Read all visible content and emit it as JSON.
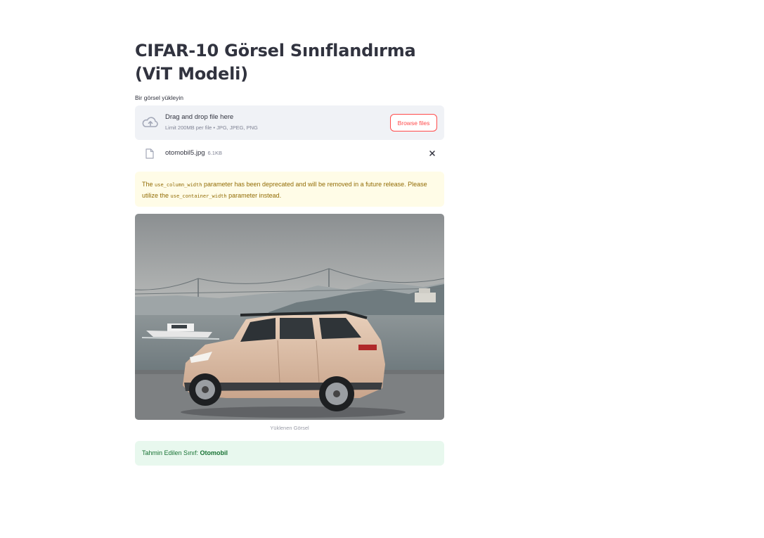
{
  "page": {
    "title": "CIFAR-10 Görsel Sınıflandırma (ViT Modeli)"
  },
  "uploader": {
    "label": "Bir görsel yükleyin",
    "drop_text": "Drag and drop file here",
    "limit_text": "Limit 200MB per file • JPG, JPEG, PNG",
    "browse_label": "Browse files",
    "icon": "cloud-upload-icon"
  },
  "uploaded_file": {
    "name": "otomobil5.jpg",
    "size": "6.1KB",
    "icon": "file-icon"
  },
  "warning": {
    "part1": "The ",
    "code1": "use_column_width",
    "part2": " parameter has been deprecated and will be removed in a future release. Please utilize the ",
    "code2": "use_container_width",
    "part3": " parameter instead."
  },
  "image": {
    "caption": "Yüklenen Görsel"
  },
  "result": {
    "label": "Tahmin Edilen Sınıf: ",
    "value": "Otomobil"
  },
  "colors": {
    "accent": "#ff4b4b",
    "warning_bg": "#fffce7",
    "warning_text": "#926c05",
    "success_bg": "#e8f8ee",
    "success_text": "#177233",
    "dropzone_bg": "#f0f2f6"
  }
}
